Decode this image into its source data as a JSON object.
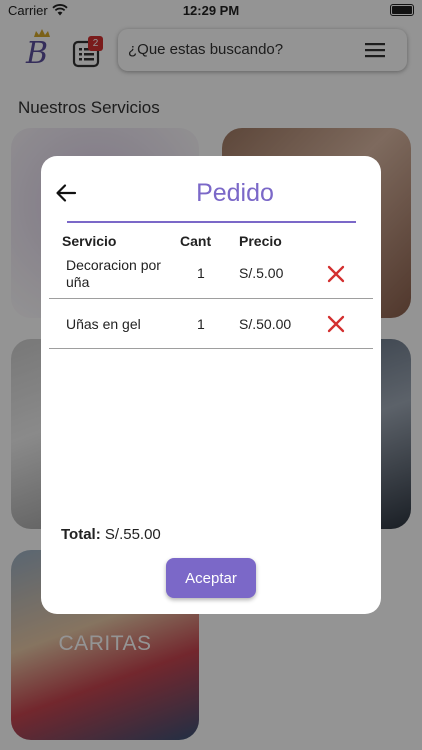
{
  "status_bar": {
    "carrier": "Carrier",
    "time": "12:29 PM"
  },
  "header": {
    "orders_badge": "2",
    "search_placeholder": "¿Que estas buscando?"
  },
  "section_title": "Nuestros Servicios",
  "cards": [
    {
      "label": ""
    },
    {
      "label": ""
    },
    {
      "label": ""
    },
    {
      "label": ""
    },
    {
      "label": "CARITAS"
    }
  ],
  "modal": {
    "title": "Pedido",
    "columns": {
      "service": "Servicio",
      "qty": "Cant",
      "price": "Precio"
    },
    "rows": [
      {
        "service": "Decoracion por uña",
        "qty": "1",
        "price": "S/.5.00"
      },
      {
        "service": "Uñas en gel",
        "qty": "1",
        "price": "S/.50.00"
      }
    ],
    "total_label": "Total:",
    "total_value": "S/.55.00",
    "accept_label": "Aceptar"
  },
  "colors": {
    "accent": "#7b68c8",
    "delete": "#d32f2f",
    "badge": "#d32f2f"
  },
  "icons": [
    "wifi-icon",
    "battery-icon",
    "logo",
    "orders-list-icon",
    "menu-icon",
    "back-arrow-icon",
    "delete-icon"
  ]
}
